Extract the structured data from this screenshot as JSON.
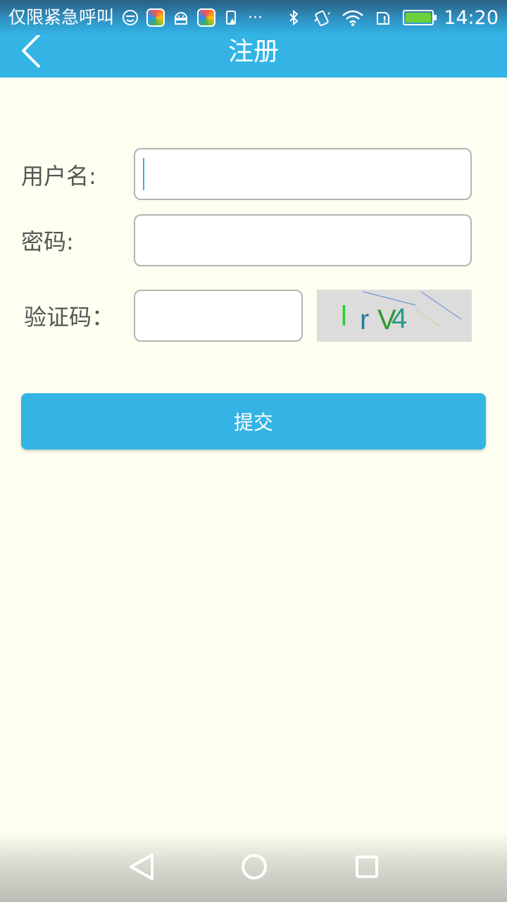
{
  "status_bar": {
    "carrier_text": "仅限紧急呼叫",
    "overflow": "···",
    "time": "14:20",
    "icons": [
      "smiley-icon",
      "app-store-icon",
      "android-icon",
      "app-store-icon",
      "storage-alert-icon",
      "overflow-icon",
      "bluetooth-icon",
      "vibrate-icon",
      "wifi-icon",
      "sim-alert-icon",
      "battery-charging-icon"
    ]
  },
  "title_bar": {
    "title": "注册",
    "back_icon": "chevron-left-icon"
  },
  "form": {
    "username_label": "用户名:",
    "username_value": "",
    "password_label": "密码:",
    "password_value": "",
    "captcha_label": "验证码：",
    "captcha_value": "",
    "captcha_chars": [
      "l",
      "r",
      "V",
      "4"
    ],
    "captcha_colors": [
      "#2bd12b",
      "#1f7fa6",
      "#2c9a2c",
      "#2a9a86"
    ],
    "submit_label": "提交"
  },
  "nav_bar": {
    "back_icon": "triangle-back-icon",
    "home_icon": "circle-home-icon",
    "recents_icon": "square-recents-icon"
  },
  "colors": {
    "accent": "#33b4e5",
    "background": "#fefff0",
    "field_border": "#b4b4b4",
    "label_text": "#555555",
    "captcha_bg": "#dcdcdc"
  }
}
